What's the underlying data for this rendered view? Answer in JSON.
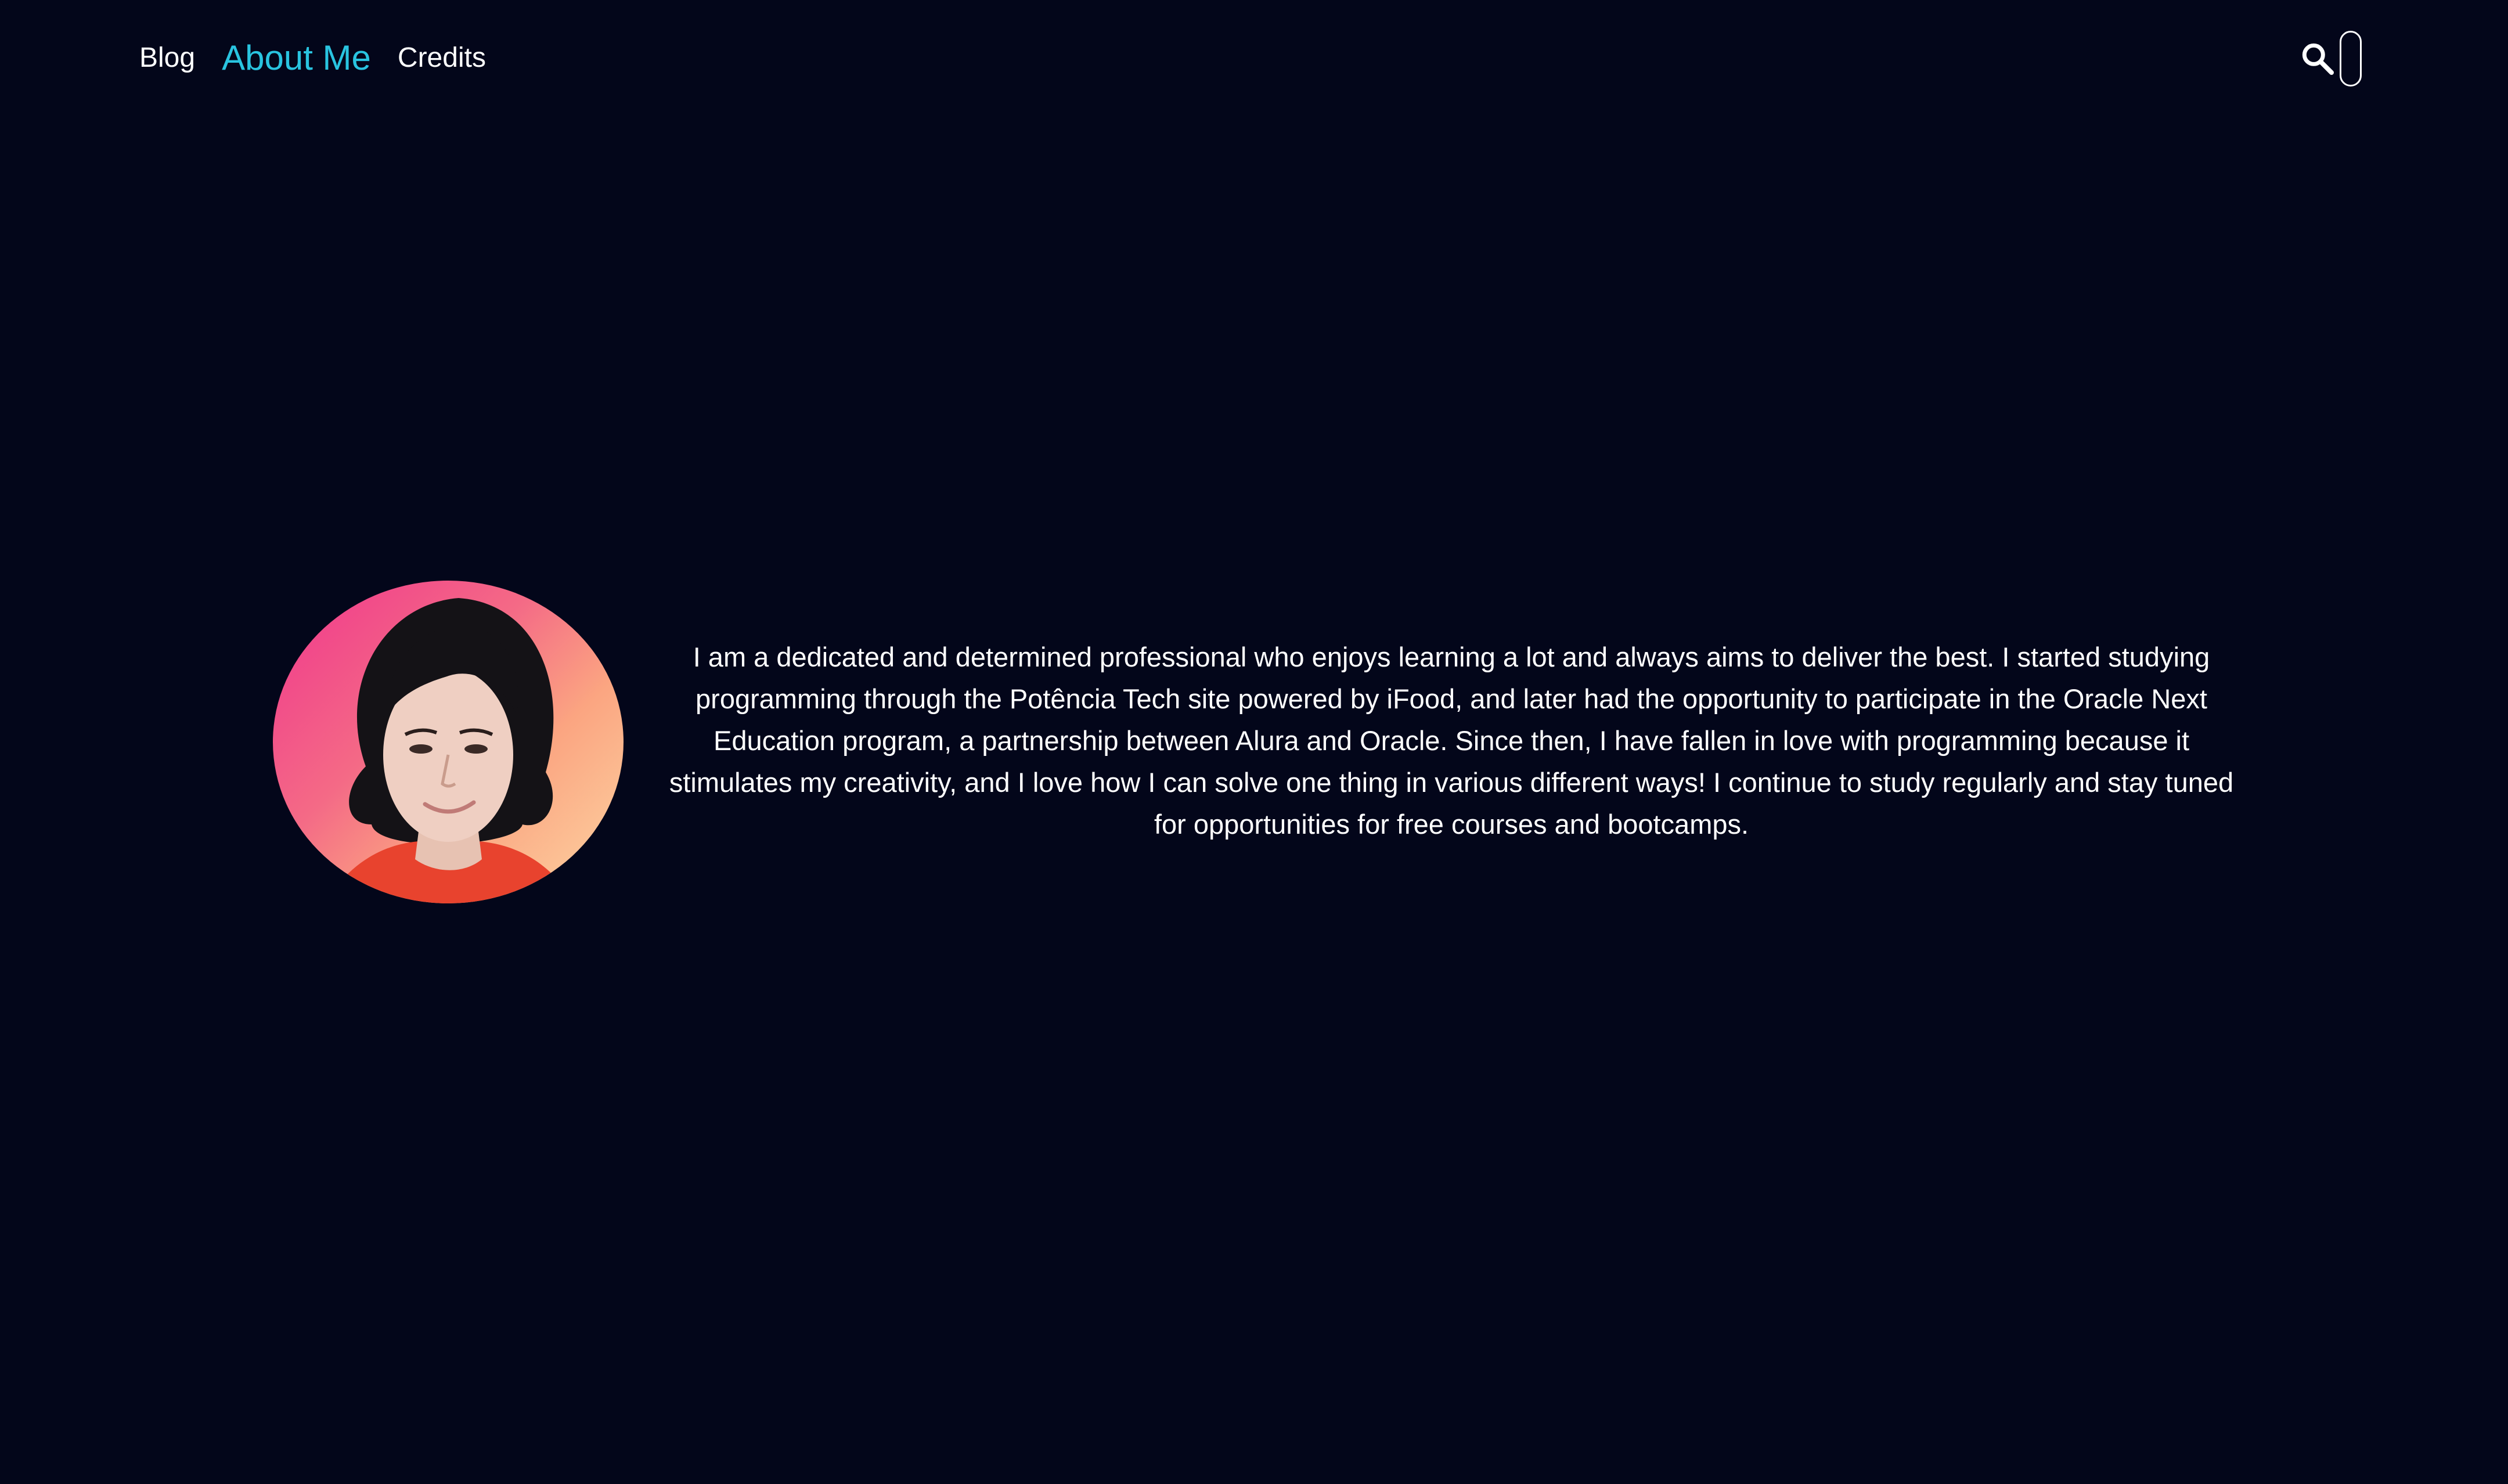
{
  "nav": {
    "items": [
      {
        "label": "Blog",
        "active": false
      },
      {
        "label": "About Me",
        "active": true
      },
      {
        "label": "Credits",
        "active": false
      }
    ]
  },
  "search": {
    "icon": "search-icon",
    "value": "",
    "placeholder": ""
  },
  "about": {
    "photo_icon": "profile-photo",
    "bio": "I am a dedicated and determined professional who enjoys learning a lot and always aims to deliver the best. I started studying programming through the Potência Tech site powered by iFood, and later had the opportunity to participate in the Oracle Next Education program, a partnership between Alura and Oracle. Since then, I have fallen in love with programming because it stimulates my creativity, and I love how I can solve one thing in various different ways! I continue to study regularly and stay tuned for opportunities for free courses and bootcamps."
  },
  "colors": {
    "background": "#03061A",
    "accent": "#29C4E0",
    "text": "#FFFFFF"
  }
}
